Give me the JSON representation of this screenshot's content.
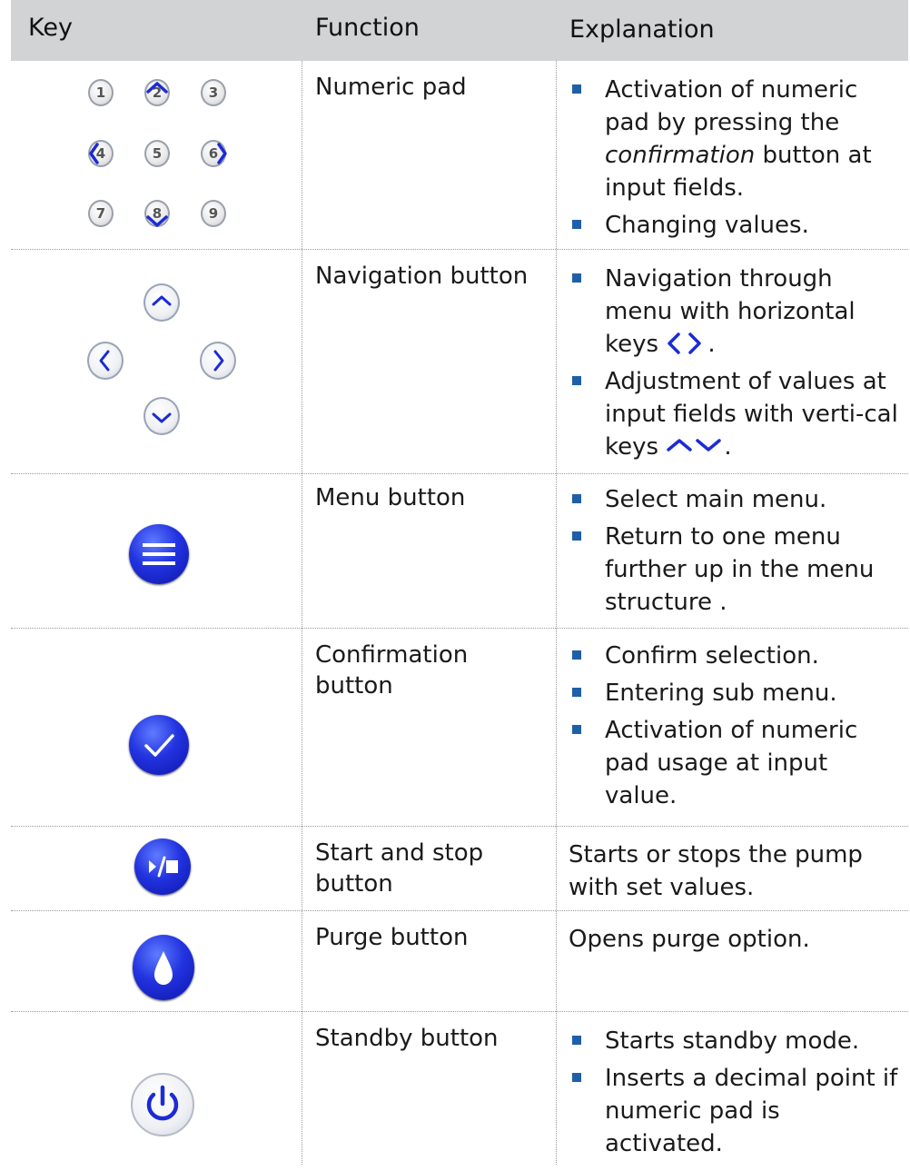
{
  "header": {
    "key": "Key",
    "function": "Function",
    "explanation": "Explanation"
  },
  "rows": [
    {
      "function": "Numeric pad",
      "key_icons": [
        "numeric-pad-icon"
      ],
      "numpad_digits": [
        "1",
        "2",
        "3",
        "4",
        "5",
        "6",
        "7",
        "8",
        "9"
      ],
      "explanation": [
        {
          "pre": "Activation of numeric pad by pressing the ",
          "em": "confirmation",
          "post": " button at input fields."
        },
        "Changing values."
      ]
    },
    {
      "function": "Navigation button",
      "key_icons": [
        "arrow-up-icon",
        "arrow-left-icon",
        "arrow-right-icon",
        "arrow-down-icon"
      ],
      "explanation": [
        "Navigation through menu with horizontal keys",
        "Adjustment of values at input fields with verti-cal keys"
      ]
    },
    {
      "function": "Menu button",
      "key_icons": [
        "menu-icon"
      ],
      "explanation": [
        "Select main menu.",
        "Return to one menu further up in the menu structure ."
      ]
    },
    {
      "function": "Confirmation button",
      "key_icons": [
        "checkmark-icon"
      ],
      "explanation": [
        "Confirm selection.",
        "Entering sub menu.",
        "Activation of numeric pad usage at input value."
      ]
    },
    {
      "function": "Start and stop button",
      "key_icons": [
        "play-stop-icon"
      ],
      "explanation_text": "Starts or stops the pump with set values."
    },
    {
      "function": "Purge button",
      "key_icons": [
        "drop-icon"
      ],
      "explanation_text": "Opens purge option."
    },
    {
      "function": "Standby button",
      "key_icons": [
        "power-icon"
      ],
      "explanation": [
        "Starts standby mode.",
        "Inserts a decimal point if numeric pad is activated."
      ]
    }
  ],
  "colors": {
    "header_bg": "#d2d3d4",
    "bullet": "#1f5fa8",
    "button_blue": "#2233e0",
    "arrow_blue": "#1c2bd6"
  }
}
